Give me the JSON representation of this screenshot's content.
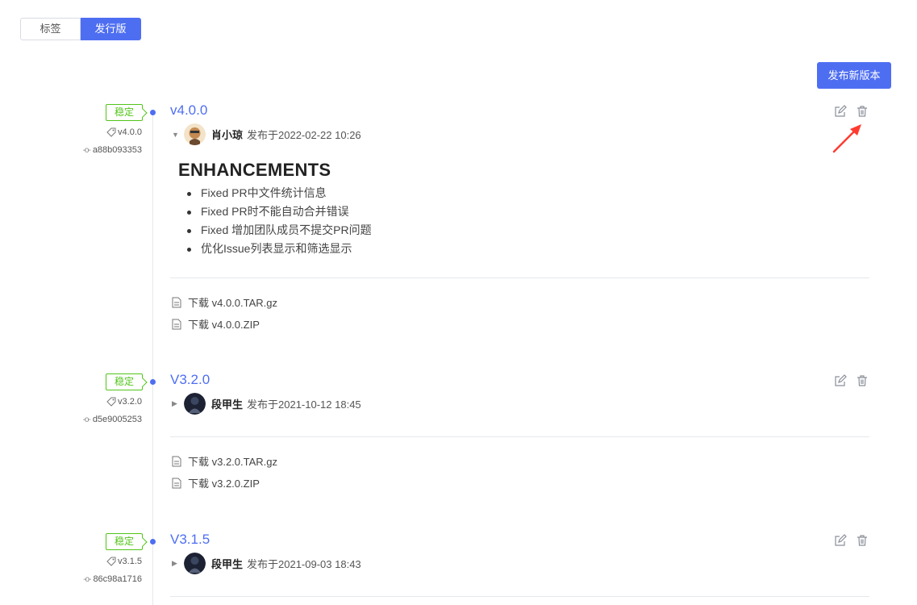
{
  "tabs": [
    {
      "label": "标签",
      "active": false
    },
    {
      "label": "发行版",
      "active": true
    }
  ],
  "new_release_button": "发布新版本",
  "colors": {
    "accent": "#4e6ef2",
    "stable": "#52c41a",
    "arrow": "#ff3b30"
  },
  "releases": [
    {
      "badge": "稳定",
      "title": "v4.0.0",
      "tag": "v4.0.0",
      "commit": "a88b093353",
      "author": "肖小琼",
      "published": "发布于2022-02-22 10:26",
      "expanded": true,
      "notes_heading": "ENHANCEMENTS",
      "notes": [
        "Fixed PR中文件统计信息",
        "Fixed PR时不能自动合并错误",
        "Fixed 增加团队成员不提交PR问题",
        "优化Issue列表显示和筛选显示"
      ],
      "downloads": [
        "下载 v4.0.0.TAR.gz",
        "下载 v4.0.0.ZIP"
      ]
    },
    {
      "badge": "稳定",
      "title": "V3.2.0",
      "tag": "v3.2.0",
      "commit": "d5e9005253",
      "author": "段甲生",
      "published": "发布于2021-10-12 18:45",
      "expanded": false,
      "downloads": [
        "下载 v3.2.0.TAR.gz",
        "下载 v3.2.0.ZIP"
      ]
    },
    {
      "badge": "稳定",
      "title": "V3.1.5",
      "tag": "v3.1.5",
      "commit": "86c98a1716",
      "author": "段甲生",
      "published": "发布于2021-09-03 18:43",
      "expanded": false,
      "downloads": []
    }
  ],
  "icons": {
    "edit": "edit-icon",
    "delete": "trash-icon",
    "tag": "tag-icon",
    "commit": "commit-icon",
    "file": "file-icon"
  }
}
